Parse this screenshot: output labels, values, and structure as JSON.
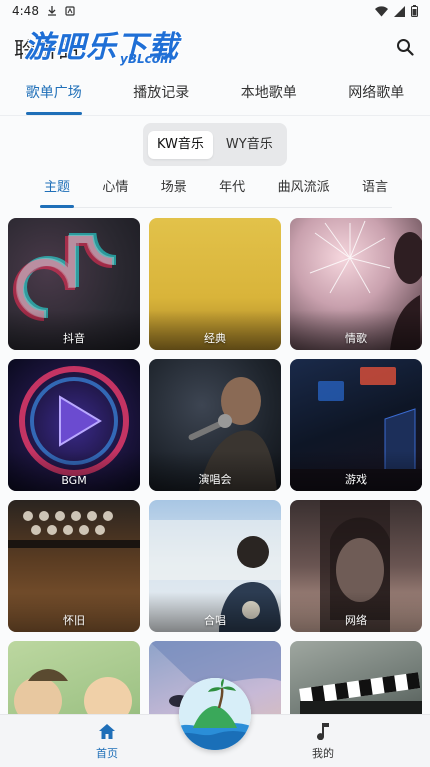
{
  "status_bar": {
    "time": "4:48"
  },
  "watermark": {
    "main": "游吧乐下载",
    "sub": "yBLcom"
  },
  "header": {
    "title": "聆听曲"
  },
  "main_tabs": [
    {
      "label": "歌单广场",
      "active": true
    },
    {
      "label": "播放记录",
      "active": false
    },
    {
      "label": "本地歌单",
      "active": false
    },
    {
      "label": "网络歌单",
      "active": false
    }
  ],
  "source_toggle": [
    {
      "label": "KW音乐",
      "active": true
    },
    {
      "label": "WY音乐",
      "active": false
    }
  ],
  "category_tabs": [
    {
      "label": "主题",
      "active": true
    },
    {
      "label": "心情",
      "active": false
    },
    {
      "label": "场景",
      "active": false
    },
    {
      "label": "年代",
      "active": false
    },
    {
      "label": "曲风流派",
      "active": false
    },
    {
      "label": "语言",
      "active": false
    }
  ],
  "playlists": [
    {
      "label": "抖音"
    },
    {
      "label": "经典"
    },
    {
      "label": "情歌"
    },
    {
      "label": "BGM"
    },
    {
      "label": "演唱会"
    },
    {
      "label": "游戏"
    },
    {
      "label": "怀旧"
    },
    {
      "label": "合唱"
    },
    {
      "label": "网络"
    },
    {
      "label": ""
    },
    {
      "label": ""
    },
    {
      "label": ""
    }
  ],
  "bottom_nav": [
    {
      "label": "首页",
      "icon": "home-icon",
      "active": true
    },
    {
      "label": "我的",
      "icon": "music-note-icon",
      "active": false
    }
  ],
  "colors": {
    "accent": "#1f6fb8",
    "watermark": "#1f6fd6"
  }
}
